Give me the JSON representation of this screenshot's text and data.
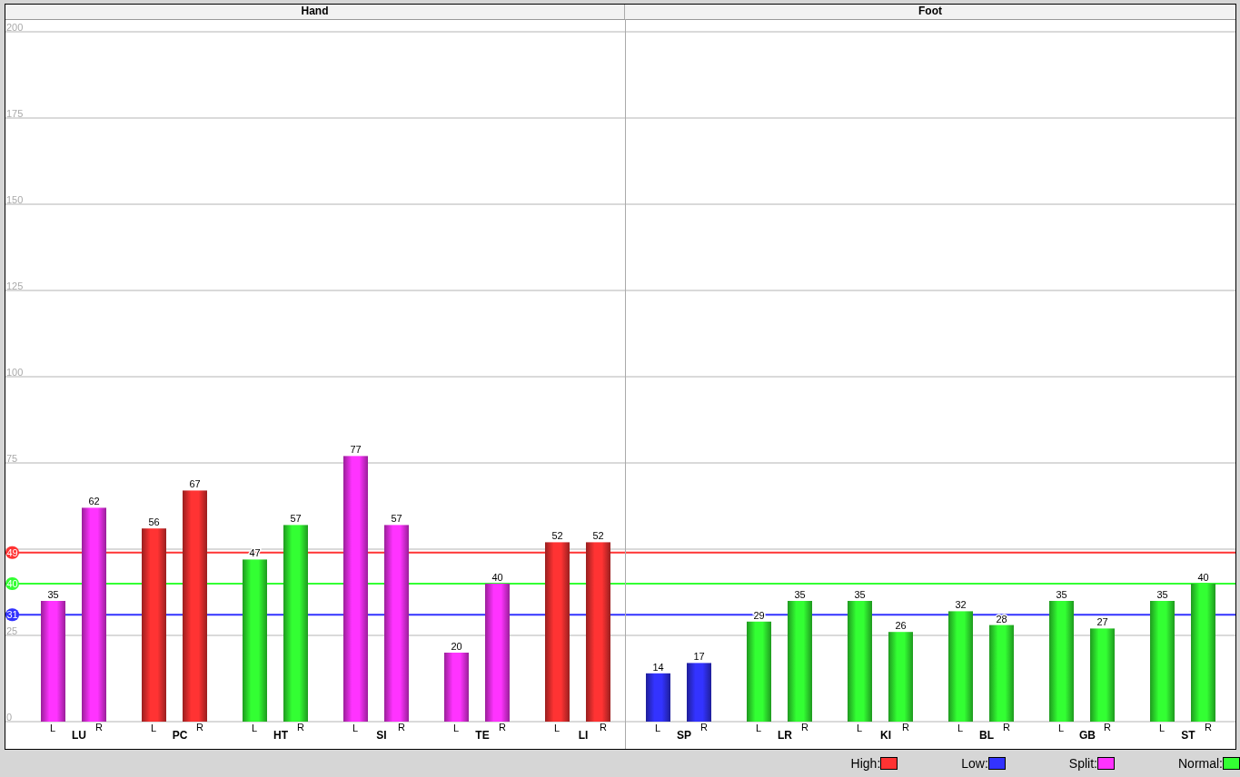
{
  "sections": [
    {
      "title": "Hand"
    },
    {
      "title": "Foot"
    }
  ],
  "chart_data": {
    "type": "bar",
    "ylim": [
      0,
      200
    ],
    "yticks": [
      0,
      25,
      75,
      100,
      125,
      150,
      175,
      200
    ],
    "grid": true,
    "data_labels": true,
    "categories": [
      "LU",
      "PC",
      "HT",
      "SI",
      "TE",
      "LI",
      "SP",
      "LR",
      "KI",
      "BL",
      "GB",
      "ST"
    ],
    "series": [
      {
        "name": "L",
        "values": [
          35,
          56,
          47,
          77,
          20,
          52,
          14,
          29,
          35,
          32,
          35,
          35
        ]
      },
      {
        "name": "R",
        "values": [
          62,
          67,
          57,
          57,
          40,
          52,
          17,
          35,
          26,
          28,
          27,
          40
        ]
      }
    ],
    "ref_lines": [
      {
        "axis": "y",
        "value": 49,
        "label": "49",
        "color": "#ff3333"
      },
      {
        "axis": "y",
        "value": 40,
        "label": "40",
        "color": "#33ff33"
      },
      {
        "axis": "y",
        "value": 31,
        "label": "31",
        "color": "#3333ff"
      }
    ]
  },
  "bars": [
    [
      {
        "kind": "split"
      },
      {
        "kind": "split"
      }
    ],
    [
      {
        "kind": "high"
      },
      {
        "kind": "high"
      }
    ],
    [
      {
        "kind": "normal"
      },
      {
        "kind": "normal"
      }
    ],
    [
      {
        "kind": "split"
      },
      {
        "kind": "split"
      }
    ],
    [
      {
        "kind": "split"
      },
      {
        "kind": "split"
      }
    ],
    [
      {
        "kind": "high"
      },
      {
        "kind": "high"
      }
    ],
    [
      {
        "kind": "low"
      },
      {
        "kind": "low"
      }
    ],
    [
      {
        "kind": "normal"
      },
      {
        "kind": "normal"
      }
    ],
    [
      {
        "kind": "normal"
      },
      {
        "kind": "normal"
      }
    ],
    [
      {
        "kind": "normal"
      },
      {
        "kind": "normal"
      }
    ],
    [
      {
        "kind": "normal"
      },
      {
        "kind": "normal"
      }
    ],
    [
      {
        "kind": "normal"
      },
      {
        "kind": "normal"
      }
    ]
  ],
  "legend": [
    {
      "label": "High:",
      "kind": "high",
      "color": "#ff3333"
    },
    {
      "label": "Low:",
      "kind": "low",
      "color": "#3333ff"
    },
    {
      "label": "Split:",
      "kind": "split",
      "color": "#ff33ff"
    },
    {
      "label": "Normal:",
      "kind": "normal",
      "color": "#33ff33"
    }
  ]
}
